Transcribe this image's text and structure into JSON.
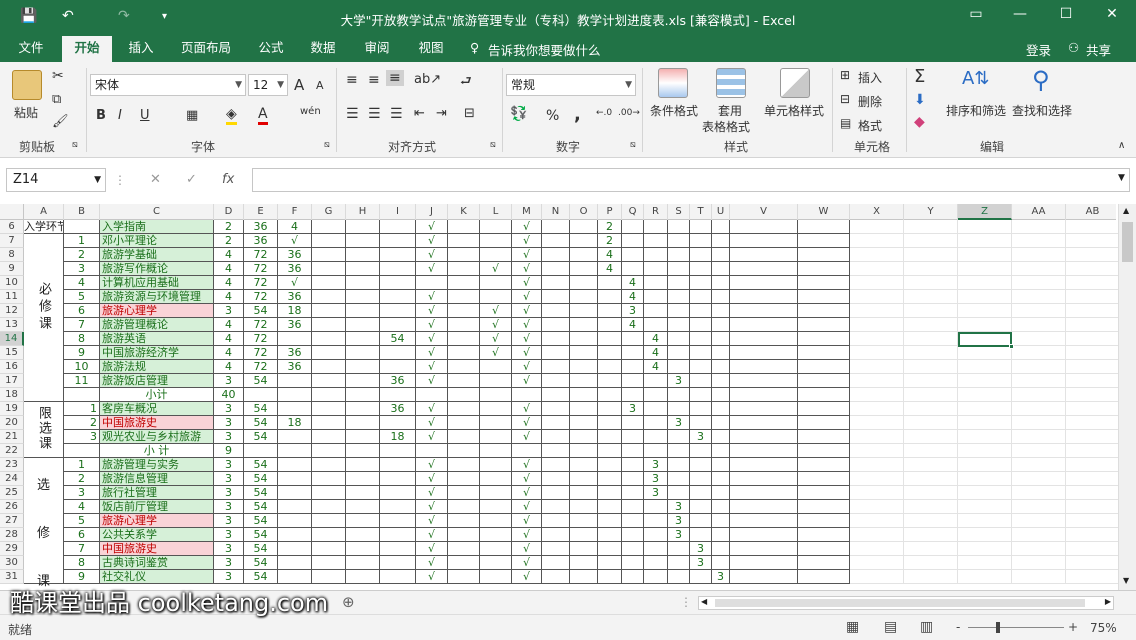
{
  "window": {
    "title": "大学\"开放教学试点\"旅游管理专业（专科）教学计划进度表.xls  [兼容模式] - Excel",
    "save": "💾",
    "undo": "↶",
    "redo": "↷",
    "custom": "▾"
  },
  "menu": {
    "tabs": [
      "文件",
      "开始",
      "插入",
      "页面布局",
      "公式",
      "数据",
      "审阅",
      "视图"
    ],
    "tellme": "告诉我你想要做什么",
    "login": "登录",
    "share": "共享"
  },
  "ribbon": {
    "clipboard": {
      "label": "剪贴板",
      "paste": "粘贴"
    },
    "font": {
      "label": "字体",
      "name": "宋体",
      "size": "12",
      "bold": "B",
      "italic": "I",
      "underline": "U",
      "grow": "A",
      "shrink": "A"
    },
    "align": {
      "label": "对齐方式"
    },
    "number": {
      "label": "数字",
      "format": "常规",
      "percent": "%",
      "comma": ","
    },
    "styles": {
      "label": "样式",
      "cond": "条件格式",
      "table1": "套用",
      "table2": "表格格式",
      "cell": "单元格样式"
    },
    "cells": {
      "label": "单元格",
      "insert": "插入",
      "delete": "删除",
      "format": "格式"
    },
    "edit": {
      "label": "编辑",
      "sum": "Σ",
      "sort": "排序和筛选",
      "find": "查找和选择"
    }
  },
  "formula": {
    "namebox": "Z14",
    "fx": "fx"
  },
  "columns": [
    "A",
    "B",
    "C",
    "D",
    "E",
    "F",
    "G",
    "H",
    "I",
    "J",
    "K",
    "L",
    "M",
    "N",
    "O",
    "P",
    "Q",
    "R",
    "S",
    "T",
    "U",
    "V",
    "W",
    "X",
    "Y",
    "Z",
    "AA",
    "AB"
  ],
  "rows": [
    "6",
    "7",
    "8",
    "9",
    "10",
    "11",
    "12",
    "13",
    "14",
    "15",
    "16",
    "17",
    "18",
    "19",
    "20",
    "21",
    "22",
    "23",
    "24",
    "25",
    "26",
    "27",
    "28",
    "29",
    "30",
    "31"
  ],
  "cells": [
    {
      "r": 0,
      "A": "入学环节",
      "C": "入学指南",
      "D": "2",
      "E": "36",
      "F": "4",
      "J": "√",
      "M": "√",
      "P": "2",
      "g": 1
    },
    {
      "r": 1,
      "B": "1",
      "C": "邓小平理论",
      "D": "2",
      "E": "36",
      "F": "√",
      "J": "√",
      "M": "√",
      "P": "2",
      "g": 1
    },
    {
      "r": 2,
      "B": "2",
      "C": "旅游学基础",
      "D": "4",
      "E": "72",
      "F": "36",
      "J": "√",
      "M": "√",
      "P": "4",
      "g": 1
    },
    {
      "r": 3,
      "B": "3",
      "C": "旅游写作概论",
      "D": "4",
      "E": "72",
      "F": "36",
      "J": "√",
      "L": "√",
      "M": "√",
      "P": "4",
      "g": 1
    },
    {
      "r": 4,
      "B": "4",
      "C": "计算机应用基础",
      "D": "4",
      "E": "72",
      "F": "√",
      "M": "√",
      "Q": "4",
      "g": 1
    },
    {
      "r": 5,
      "B": "5",
      "C": "旅游资源与环境管理",
      "D": "4",
      "E": "72",
      "F": "36",
      "J": "√",
      "M": "√",
      "Q": "4",
      "g": 1
    },
    {
      "r": 6,
      "B": "6",
      "C": "旅游心理学",
      "D": "3",
      "E": "54",
      "F": "18",
      "J": "√",
      "L": "√",
      "M": "√",
      "Q": "3",
      "p": 1
    },
    {
      "r": 7,
      "B": "7",
      "C": "旅游管理概论",
      "D": "4",
      "E": "72",
      "F": "36",
      "J": "√",
      "L": "√",
      "M": "√",
      "Q": "4",
      "g": 1
    },
    {
      "r": 8,
      "B": "8",
      "C": "旅游英语",
      "D": "4",
      "E": "72",
      "I": "54",
      "J": "√",
      "L": "√",
      "M": "√",
      "R": "4",
      "g": 1
    },
    {
      "r": 9,
      "B": "9",
      "C": "中国旅游经济学",
      "D": "4",
      "E": "72",
      "F": "36",
      "J": "√",
      "L": "√",
      "M": "√",
      "R": "4",
      "g": 1
    },
    {
      "r": 10,
      "B": "10",
      "C": "旅游法规",
      "D": "4",
      "E": "72",
      "F": "36",
      "J": "√",
      "M": "√",
      "R": "4",
      "g": 1
    },
    {
      "r": 11,
      "B": "11",
      "C": "旅游饭店管理",
      "D": "3",
      "E": "54",
      "I": "36",
      "J": "√",
      "M": "√",
      "S": "3",
      "g": 1
    },
    {
      "r": 12,
      "C": "小计",
      "D": "40"
    },
    {
      "r": 13,
      "B": "1",
      "C": "客房车概况",
      "D": "3",
      "E": "54",
      "I": "36",
      "J": "√",
      "M": "√",
      "Q": "3",
      "g": 1
    },
    {
      "r": 14,
      "B": "2",
      "C": "中国旅游史",
      "D": "3",
      "E": "54",
      "F": "18",
      "J": "√",
      "M": "√",
      "S": "3",
      "p": 1
    },
    {
      "r": 15,
      "B": "3",
      "C": "观光农业与乡村旅游",
      "D": "3",
      "E": "54",
      "I": "18",
      "J": "√",
      "M": "√",
      "T": "3",
      "g": 1
    },
    {
      "r": 16,
      "C": "小 计",
      "D": "9"
    },
    {
      "r": 17,
      "B": "1",
      "C": "旅游管理与实务",
      "D": "3",
      "E": "54",
      "J": "√",
      "M": "√",
      "R": "3",
      "g": 1
    },
    {
      "r": 18,
      "B": "2",
      "C": "旅游信息管理",
      "D": "3",
      "E": "54",
      "J": "√",
      "M": "√",
      "R": "3",
      "g": 1
    },
    {
      "r": 19,
      "B": "3",
      "C": "旅行社管理",
      "D": "3",
      "E": "54",
      "J": "√",
      "M": "√",
      "R": "3",
      "g": 1
    },
    {
      "r": 20,
      "B": "4",
      "C": "饭店前厅管理",
      "D": "3",
      "E": "54",
      "J": "√",
      "M": "√",
      "S": "3",
      "g": 1
    },
    {
      "r": 21,
      "B": "5",
      "C": "旅游心理学",
      "D": "3",
      "E": "54",
      "J": "√",
      "M": "√",
      "S": "3",
      "p": 1
    },
    {
      "r": 22,
      "B": "6",
      "C": "公共关系学",
      "D": "3",
      "E": "54",
      "J": "√",
      "M": "√",
      "S": "3",
      "g": 1
    },
    {
      "r": 23,
      "B": "7",
      "C": "中国旅游史",
      "D": "3",
      "E": "54",
      "J": "√",
      "M": "√",
      "T": "3",
      "p": 1
    },
    {
      "r": 24,
      "B": "8",
      "C": "古典诗词鉴赏",
      "D": "3",
      "E": "54",
      "J": "√",
      "M": "√",
      "T": "3",
      "g": 1
    },
    {
      "r": 25,
      "B": "9",
      "C": "社交礼仪",
      "D": "3",
      "E": "54",
      "J": "√",
      "M": "√",
      "U": "3",
      "g": 1
    }
  ],
  "merged": {
    "req": "必修课",
    "lim": "限选课",
    "ele1": "选",
    "ele2": "修",
    "ele3": "课"
  },
  "sheet": {
    "add": "⊕"
  },
  "status": {
    "ready": "就绪",
    "zoom": "75%",
    "minus": "-",
    "plus": "+"
  },
  "watermark": "酷课堂出品 coolketang.com"
}
